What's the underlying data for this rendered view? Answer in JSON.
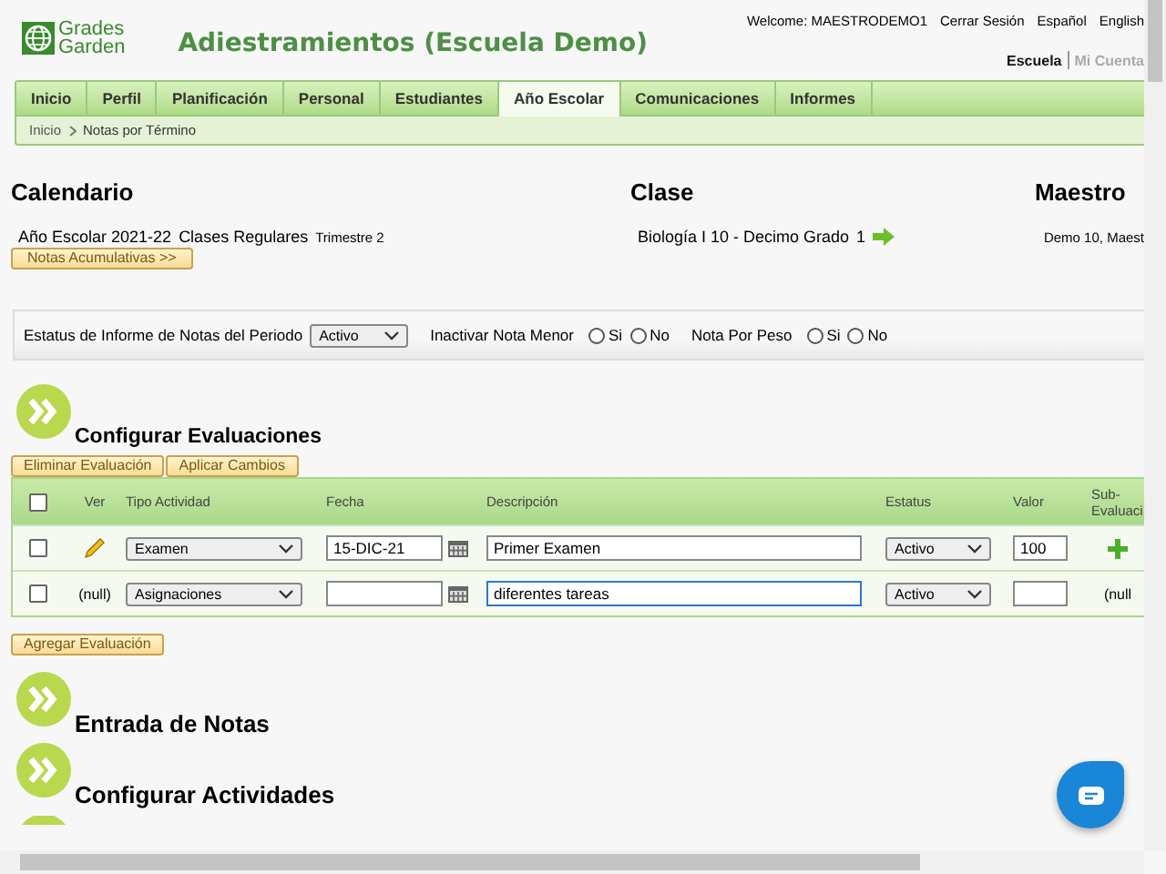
{
  "header": {
    "logo_line1": "Grades",
    "logo_line2": "Garden",
    "title": "Adiestramientos (Escuela Demo)",
    "welcome": "Welcome: MAESTRODEMO1",
    "links": [
      "Cerrar Sesión",
      "Español",
      "English"
    ],
    "account_links": [
      {
        "label": "Escuela",
        "selected": true
      },
      {
        "label": "Mi Cuenta",
        "selected": false
      }
    ]
  },
  "tabs": [
    {
      "label": "Inicio",
      "selected": false
    },
    {
      "label": "Perfil",
      "selected": false
    },
    {
      "label": "Planificación",
      "selected": false
    },
    {
      "label": "Personal",
      "selected": false
    },
    {
      "label": "Estudiantes",
      "selected": false
    },
    {
      "label": "Año Escolar",
      "selected": true
    },
    {
      "label": "Comunicaciones",
      "selected": false
    },
    {
      "label": "Informes",
      "selected": false
    }
  ],
  "breadcrumb": [
    "Inicio",
    "Notas por Término"
  ],
  "info": {
    "calendar": {
      "heading": "Calendario",
      "year": "Año Escolar 2021-22",
      "type": "Clases Regulares",
      "term": "Trimestre 2",
      "button": "Notas Acumulativas >>"
    },
    "class": {
      "heading": "Clase",
      "name": "Biología I 10 -  Decimo Grado",
      "number": "1"
    },
    "teacher": {
      "heading": "Maestro",
      "name": "Demo 10, Maest"
    }
  },
  "options": {
    "status_label": "Estatus de Informe de Notas del Periodo",
    "status_value": "Activo",
    "toggles": [
      {
        "label": "Inactivar Nota Menor",
        "options": [
          {
            "label": "Si",
            "selected": false
          },
          {
            "label": "No",
            "selected": false
          }
        ]
      },
      {
        "label": "Nota Por Peso",
        "options": [
          {
            "label": "Si",
            "selected": false
          },
          {
            "label": "No",
            "selected": false
          }
        ]
      }
    ]
  },
  "evaluations": {
    "title": "Configurar Evaluaciones",
    "buttons": [
      "Eliminar Evaluación",
      "Aplicar Cambios"
    ],
    "table": {
      "header_checked": false,
      "columns": [
        "Ver",
        "Tipo Actividad",
        "Fecha",
        "Descripción",
        "Estatus",
        "Valor",
        "Sub-\nEvaluaci"
      ],
      "rows": [
        {
          "checked": false,
          "ver": {
            "kind": "pencil"
          },
          "type": "Examen",
          "date": "15-DIC-21",
          "description": "Primer Examen",
          "focused": false,
          "status": "Activo",
          "value": "100",
          "sub": {
            "kind": "add"
          }
        },
        {
          "checked": false,
          "ver": {
            "kind": "text",
            "text": "(null)"
          },
          "type": "Asignaciones",
          "date": "",
          "description": "diferentes tareas",
          "focused": true,
          "status": "Activo",
          "value": "",
          "sub": {
            "kind": "text",
            "text": "(null"
          }
        }
      ]
    },
    "add_button": "Agregar Evaluación"
  },
  "collapsed_sections": [
    "Entrada de Notas",
    "Configurar Actividades"
  ]
}
